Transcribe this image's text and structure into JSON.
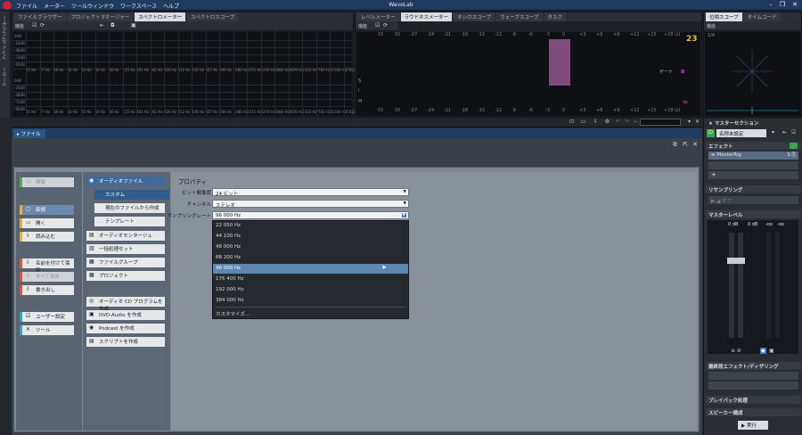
{
  "app": {
    "title": "WaveLab",
    "menu": [
      "ファイル",
      "メーター",
      "ツールウィンドウ",
      "ワークスペース",
      "ヘルプ"
    ],
    "accent": "#2a5587"
  },
  "left_strip": {
    "items": [
      "ファイルブラウザー",
      "マーカー"
    ]
  },
  "panel1": {
    "tabs": [
      "ファイルブラウザー",
      "プロジェクトマネージャー",
      "スペクトロメーター",
      "スペクトロスコープ"
    ],
    "tool_label": "機能",
    "y_ticks": [
      "0dB",
      "-24dB",
      "-48dB",
      "-72dB",
      "-96dB"
    ],
    "x_ticks": [
      "25 Hz",
      "27 Hz",
      "38 Hz",
      "43 Hz",
      "55 Hz",
      "60 Hz",
      "86 Hz",
      "115 Hz",
      "161 Hz",
      "181 Hz",
      "226 Hz",
      "312 Hz",
      "436 Hz",
      "607 Hz",
      "846 Hz",
      "1180 Hz",
      "1721 Hz",
      "2259 Hz",
      "2880 Hz",
      "3859 Hz",
      "5333 Hz",
      "7783 Hz",
      "11344 Hz",
      "17302 Hz"
    ]
  },
  "panel2": {
    "tabs": [
      "レベルメーター",
      "ラウドネスメーター",
      "オシロスコープ",
      "ウェーブスコープ",
      "タスク"
    ],
    "tool_label": "機能",
    "scale": [
      "-33",
      "-30",
      "-27",
      "-24",
      "-21",
      "-18",
      "-15",
      "-12",
      "-9",
      "-6",
      "-3",
      "0",
      "+3",
      "+6",
      "+9",
      "+12",
      "+15",
      "+18 LU"
    ],
    "rows": [
      "S",
      "I",
      "M"
    ],
    "gate_label": "ゲート",
    "tp_label": "TP",
    "badge": "23"
  },
  "panel3": {
    "tabs": [
      "位相スコープ",
      "タイムコード"
    ],
    "tool_label": "機能",
    "corner": "1/4"
  },
  "file_tab": {
    "label": "ファイル"
  },
  "col1": {
    "items": [
      {
        "label": "情報",
        "icon": "ⓘ",
        "disabled": true,
        "color": "#4caf50"
      },
      {
        "label": "新規",
        "icon": "▢",
        "active": true,
        "color": "#e2b233"
      },
      {
        "label": "開く",
        "icon": "▭",
        "color": "#e2b233"
      },
      {
        "label": "読み込む",
        "icon": "⇩",
        "color": "#e2b233"
      },
      {
        "label": "名前を付けて保存",
        "icon": "⇩",
        "color": "#d9533c"
      },
      {
        "label": "すべて保存",
        "icon": "⇩",
        "disabled": true,
        "color": "#d9533c"
      },
      {
        "label": "書き出し",
        "icon": "⇩",
        "color": "#d9533c"
      },
      {
        "label": "ユーザー設定",
        "icon": "☑",
        "color": "#2aa6c9"
      },
      {
        "label": "ツール",
        "icon": "✕",
        "color": "#2aa6c9"
      }
    ]
  },
  "col2": {
    "items": [
      "オーディオファイル",
      "カスタム",
      "現在のファイルから作成",
      "テンプレート",
      "オーディオモンタージュ",
      "一括処理セット",
      "ファイルグループ",
      "プロジェクト",
      "オーディオ CD プログラムを作成",
      "DVD-Audio を作成",
      "Podcast を作成",
      "スクリプトを作成"
    ]
  },
  "props": {
    "title": "プロパティ",
    "bit_label": "ビット解像度",
    "bit_value": "24 ビット",
    "channel_label": "チャンネル",
    "channel_value": "ステレオ",
    "rate_label": "サンプリングレート",
    "rate_value": "96 000 Hz",
    "options": [
      "22 050 Hz",
      "44 100 Hz",
      "48 000 Hz",
      "88 200 Hz",
      "96 000 Hz",
      "176 400 Hz",
      "192 000 Hz",
      "384 000 Hz",
      "カスタマイズ..."
    ],
    "selected_index": 4
  },
  "master": {
    "title": "マスターセクション",
    "preset": "名称未設定",
    "effects": "エフェクト",
    "plugin": "MasterRig",
    "resampling": "リサンプリング",
    "off": "オフ",
    "level": "マスターレベル",
    "level_values": [
      "0 dB",
      "0 dB",
      "-oo",
      "-oo"
    ],
    "final": "最終段エフェクト/ディザリング",
    "playback": "プレイバック処理",
    "speaker": "スピーカー構成",
    "render": "実行"
  }
}
